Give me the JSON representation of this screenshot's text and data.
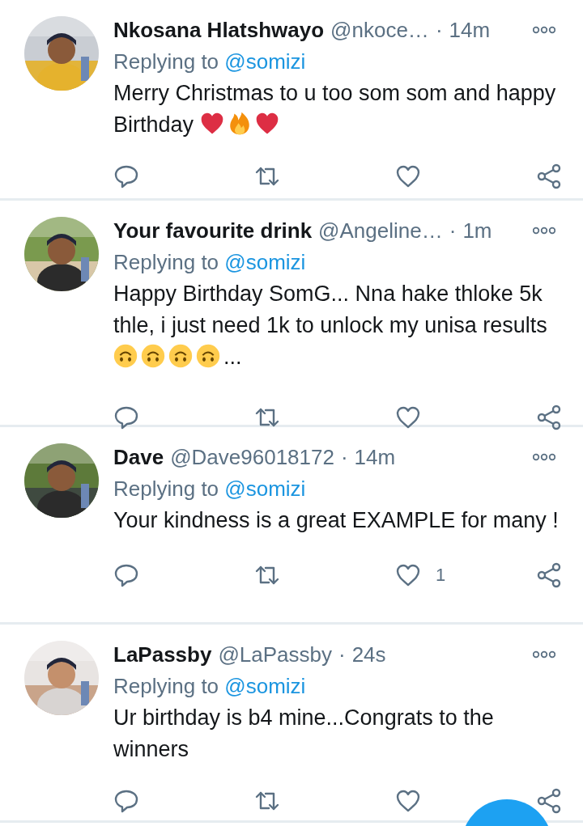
{
  "tweets": [
    {
      "name": "Nkosana Hlatshwayo",
      "handle": "@nkoce…",
      "separator": "·",
      "time": "14m",
      "replying_label": "Replying to",
      "replying_to": "@somizi",
      "body": [
        {
          "kind": "text",
          "text": "Merry Christmas to u too som som and happy Birthday "
        },
        {
          "kind": "heart"
        },
        {
          "kind": "fire"
        },
        {
          "kind": "heart"
        }
      ]
    },
    {
      "name": "Your favourite drink",
      "handle": "@Angeline…",
      "separator": "·",
      "time": "1m",
      "replying_label": "Replying to",
      "replying_to": "@somizi",
      "body": [
        {
          "kind": "text",
          "text": "Happy Birthday SomG... Nna hake thloke 5k thle, i just need 1k to unlock my unisa results"
        },
        {
          "kind": "upside-down-face"
        },
        {
          "kind": "upside-down-face"
        },
        {
          "kind": "upside-down-face"
        },
        {
          "kind": "upside-down-face"
        },
        {
          "kind": "text",
          "text": "..."
        }
      ]
    },
    {
      "name": "Dave",
      "handle": "@Dave96018172",
      "separator": "·",
      "time": "14m",
      "replying_label": "Replying to",
      "replying_to": "@somizi",
      "body": [
        {
          "kind": "text",
          "text": "Your kindness is a great EXAMPLE for many !"
        }
      ],
      "likes": "1"
    },
    {
      "name": "LaPassby",
      "handle": "@LaPassby",
      "separator": "·",
      "time": "24s",
      "replying_label": "Replying to",
      "replying_to": "@somizi",
      "body": [
        {
          "kind": "text",
          "text": "Ur birthday is b4 mine...Congrats to the winners"
        }
      ]
    }
  ]
}
